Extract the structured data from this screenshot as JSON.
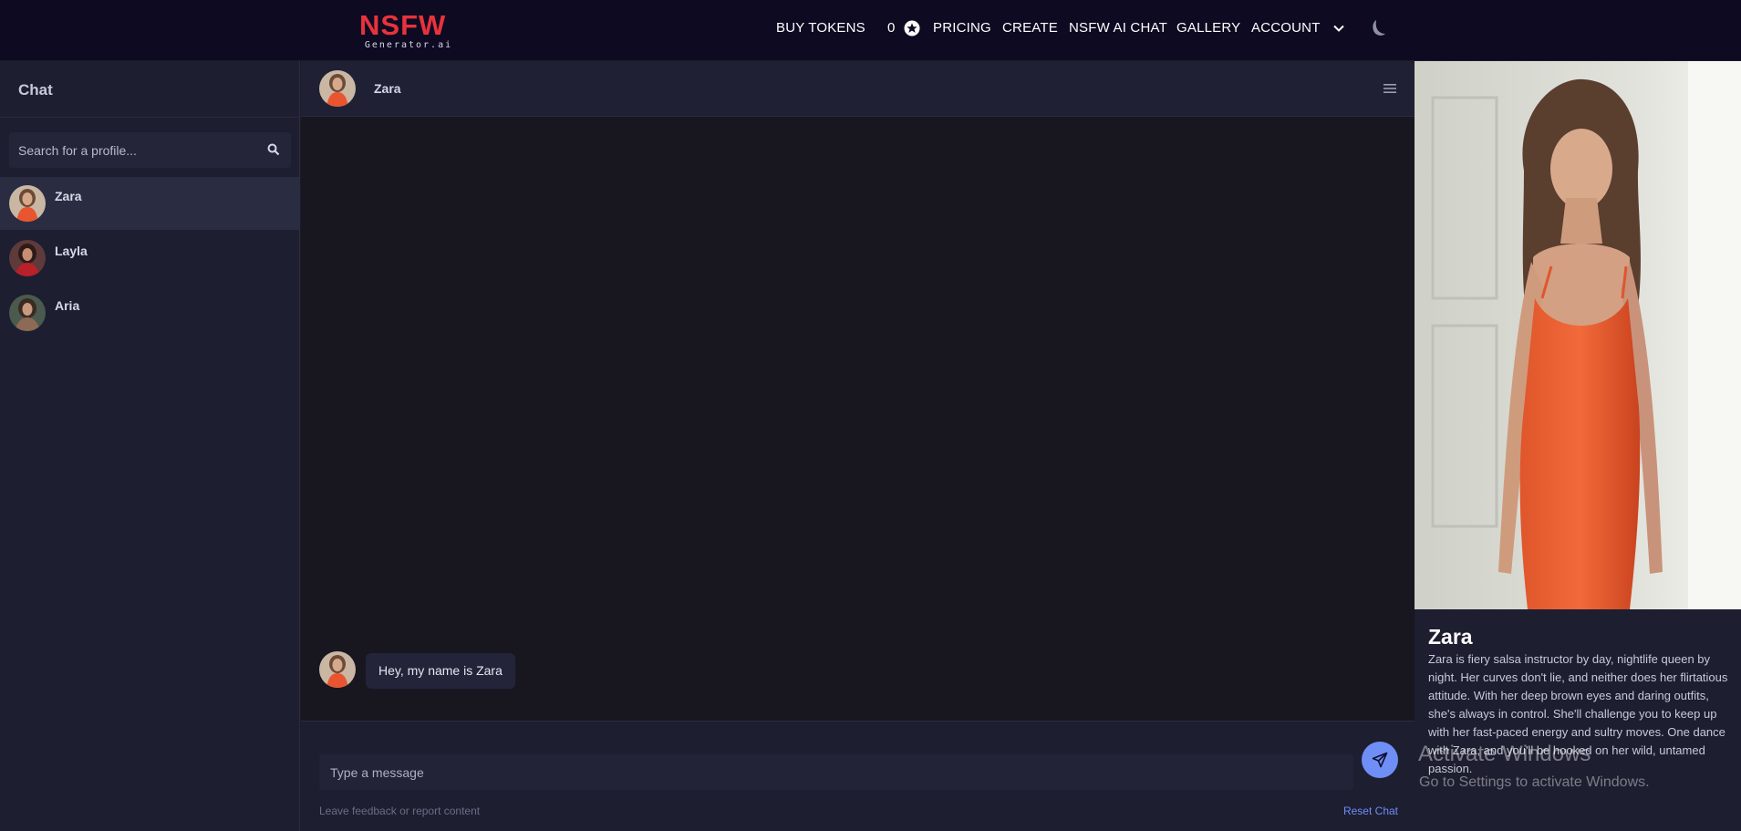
{
  "brand": {
    "logo_main": "NSFW",
    "logo_sub": "Generator.ai",
    "accent": "#e8323c"
  },
  "nav": {
    "buy_tokens": "BUY TOKENS",
    "token_count": "0",
    "pricing": "PRICING",
    "create": "CREATE",
    "nsfw_ai_chat": "NSFW AI CHAT",
    "gallery": "GALLERY",
    "account": "ACCOUNT",
    "icons": [
      "star-token-icon",
      "chevron-down-icon",
      "moon-icon"
    ]
  },
  "sidebar": {
    "title": "Chat",
    "search_placeholder": "Search for a profile...",
    "profiles": [
      {
        "name": "Zara",
        "active": true
      },
      {
        "name": "Layla",
        "active": false
      },
      {
        "name": "Aria",
        "active": false
      }
    ]
  },
  "chat": {
    "header_name": "Zara",
    "messages": [
      {
        "sender": "Zara",
        "text": "Hey, my name is Zara"
      }
    ],
    "input_placeholder": "Type a message",
    "feedback_link": "Leave feedback or report content",
    "reset_link": "Reset Chat",
    "send_color": "#6f8ef6"
  },
  "profile_panel": {
    "name": "Zara",
    "description": "Zara is fiery salsa instructor by day, nightlife queen by night. Her curves don't lie, and neither does her flirtatious attitude. With her deep brown eyes and daring outfits, she's always in control. She'll challenge you to keep up with her fast-paced energy and sultry moves. One dance with Zara, and you'll be hooked on her wild, untamed passion."
  },
  "watermark": {
    "line1": "Activate Windows",
    "line2": "Go to Settings to activate Windows."
  }
}
